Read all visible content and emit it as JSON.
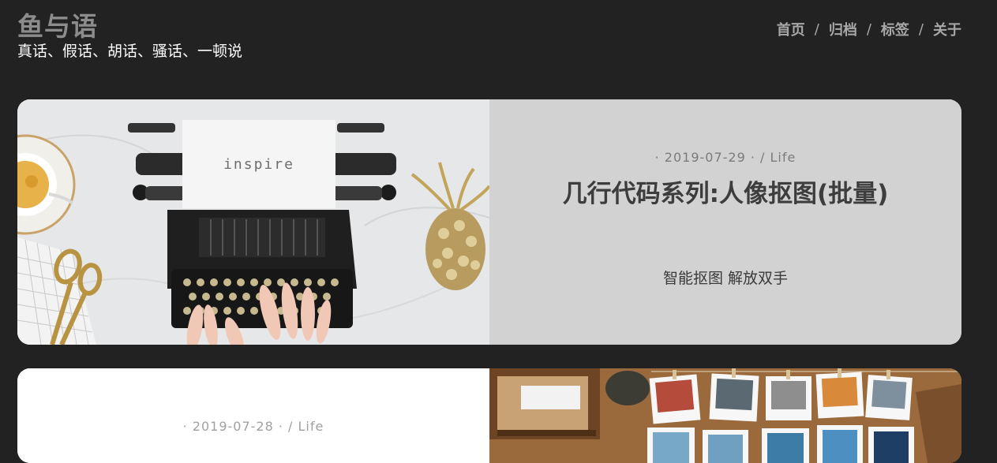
{
  "site": {
    "title": "鱼与语",
    "subtitle": "真话、假话、胡话、骚话、一顿说"
  },
  "nav": {
    "items": [
      {
        "label": "首页"
      },
      {
        "label": "归档"
      },
      {
        "label": "标签"
      },
      {
        "label": "关于"
      }
    ],
    "separator": "/"
  },
  "posts": [
    {
      "meta": "· 2019-07-29 · / Life",
      "title": "几行代码系列:人像抠图(批量)",
      "excerpt": "智能抠图 解放双手",
      "image_text": "inspire"
    },
    {
      "meta": "· 2019-07-28 · / Life"
    }
  ],
  "colors": {
    "background": "#222222",
    "title_gray": "#8c8c8c",
    "card1_bg": "#d2d2d2",
    "card2_bg": "#ffffff"
  }
}
